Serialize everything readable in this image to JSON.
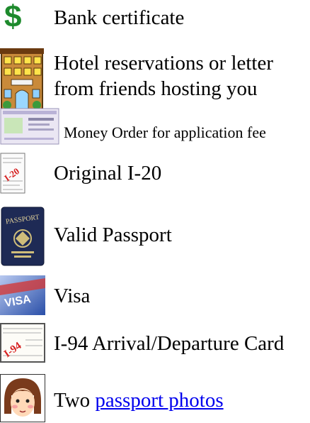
{
  "items": [
    {
      "icon": "dollar-sign-icon",
      "label": "Bank certificate"
    },
    {
      "icon": "hotel-icon",
      "label_line1": "Hotel reservations or letter",
      "label_line2": "from friends hosting you"
    },
    {
      "icon": "money-order-icon",
      "label": "Money Order for application fee"
    },
    {
      "icon": "i20-document-icon",
      "label": "Original I-20",
      "stamp": "I-20"
    },
    {
      "icon": "passport-icon",
      "label": "Valid Passport",
      "badge": "PASSPORT"
    },
    {
      "icon": "visa-icon",
      "label": "Visa",
      "badge": "VISA"
    },
    {
      "icon": "i94-card-icon",
      "label": "I-94 Arrival/Departure Card",
      "stamp": "I-94"
    },
    {
      "icon": "girl-photo-icon",
      "label_prefix": "Two",
      "link_text": "passport photos"
    }
  ],
  "dollar_symbol": "$",
  "colors": {
    "link": "#0000ee",
    "dollar": "#1d8a2c",
    "stamp": "#d62020"
  }
}
